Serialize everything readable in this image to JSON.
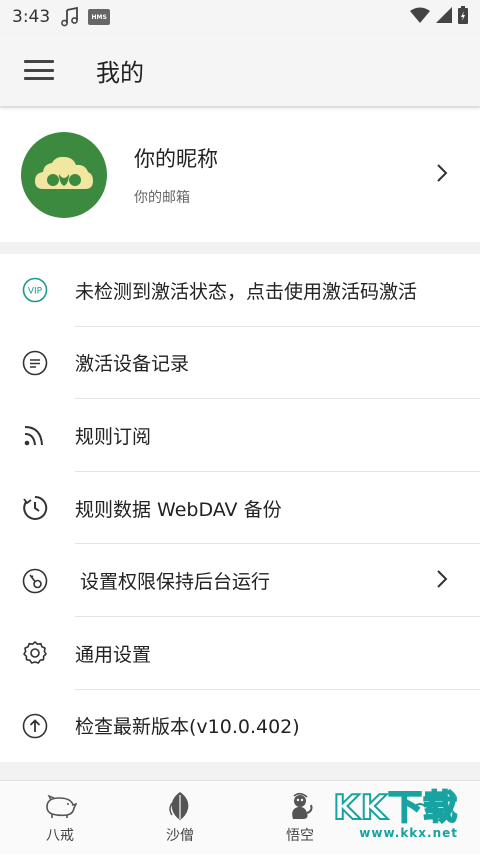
{
  "status": {
    "time": "3:43",
    "hms_badge": "HMS"
  },
  "appbar": {
    "title": "我的"
  },
  "profile": {
    "nickname": "你的昵称",
    "email": "你的邮箱"
  },
  "menu": {
    "items": [
      {
        "label": "未检测到激活状态，点击使用激活码激活",
        "icon": "vip-icon"
      },
      {
        "label": "激活设备记录",
        "icon": "list-icon"
      },
      {
        "label": "规则订阅",
        "icon": "rss-icon"
      },
      {
        "label": "规则数据 WebDAV 备份",
        "icon": "backup-clock-icon"
      },
      {
        "label": "设置权限保持后台运行",
        "icon": "key-icon"
      },
      {
        "label": "通用设置",
        "icon": "gear-icon"
      },
      {
        "label": "检查最新版本(v10.0.402)",
        "icon": "upgrade-icon"
      }
    ]
  },
  "bottom_nav": {
    "tabs": [
      {
        "label": "八戒",
        "icon": "pig-icon"
      },
      {
        "label": "沙僧",
        "icon": "leaf-icon"
      },
      {
        "label": "悟空",
        "icon": "monkey-icon"
      },
      {
        "label": "",
        "icon": "profile-tab-icon"
      }
    ]
  },
  "watermark": {
    "text": "KK下载",
    "url": "www.kkx.net"
  },
  "colors": {
    "accent": "#1a9a8c",
    "avatar_bg": "#3b8a3f",
    "avatar_cloud": "#f2e7a0"
  }
}
